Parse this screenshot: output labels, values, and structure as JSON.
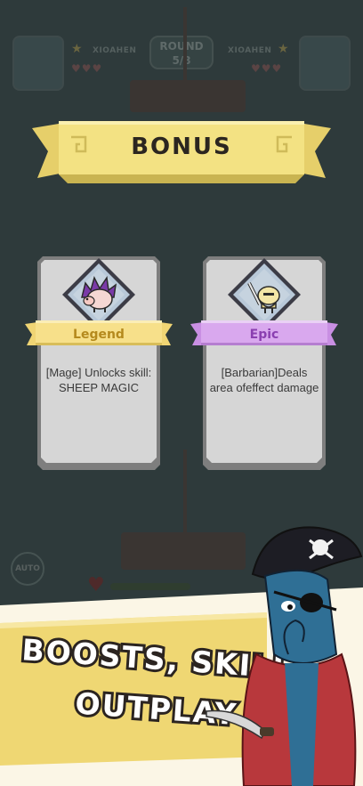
{
  "header": {
    "round_label": "ROUND",
    "round_value": "5/8",
    "left_player_name": "XIOAHEN",
    "right_player_name": "XIOAHEN"
  },
  "bonus": {
    "title": "BONUS"
  },
  "cards": [
    {
      "rarity": "Legend",
      "description": "[Mage] Unlocks skill: SHEEP MAGIC",
      "icon": "sheep-icon",
      "banner_color": "#f7e08a",
      "label_color": "#b58a1d"
    },
    {
      "rarity": "Epic",
      "description": "[Barbarian]Deals area ofeffect damage",
      "icon": "knight-icon",
      "banner_color": "#d9a8ee",
      "label_color": "#8a3fb0"
    }
  ],
  "controls": {
    "auto_label": "AUTO"
  },
  "promo": {
    "line1": "BOOSTS, SKILLS,",
    "line2": "OUTPLAY"
  },
  "colors": {
    "ribbon": "#f3e283",
    "ribbon_shadow": "#c9b451",
    "card_bg": "#d4d4d4",
    "card_border": "#7d7d7d",
    "promo_yellow": "#efd773"
  }
}
